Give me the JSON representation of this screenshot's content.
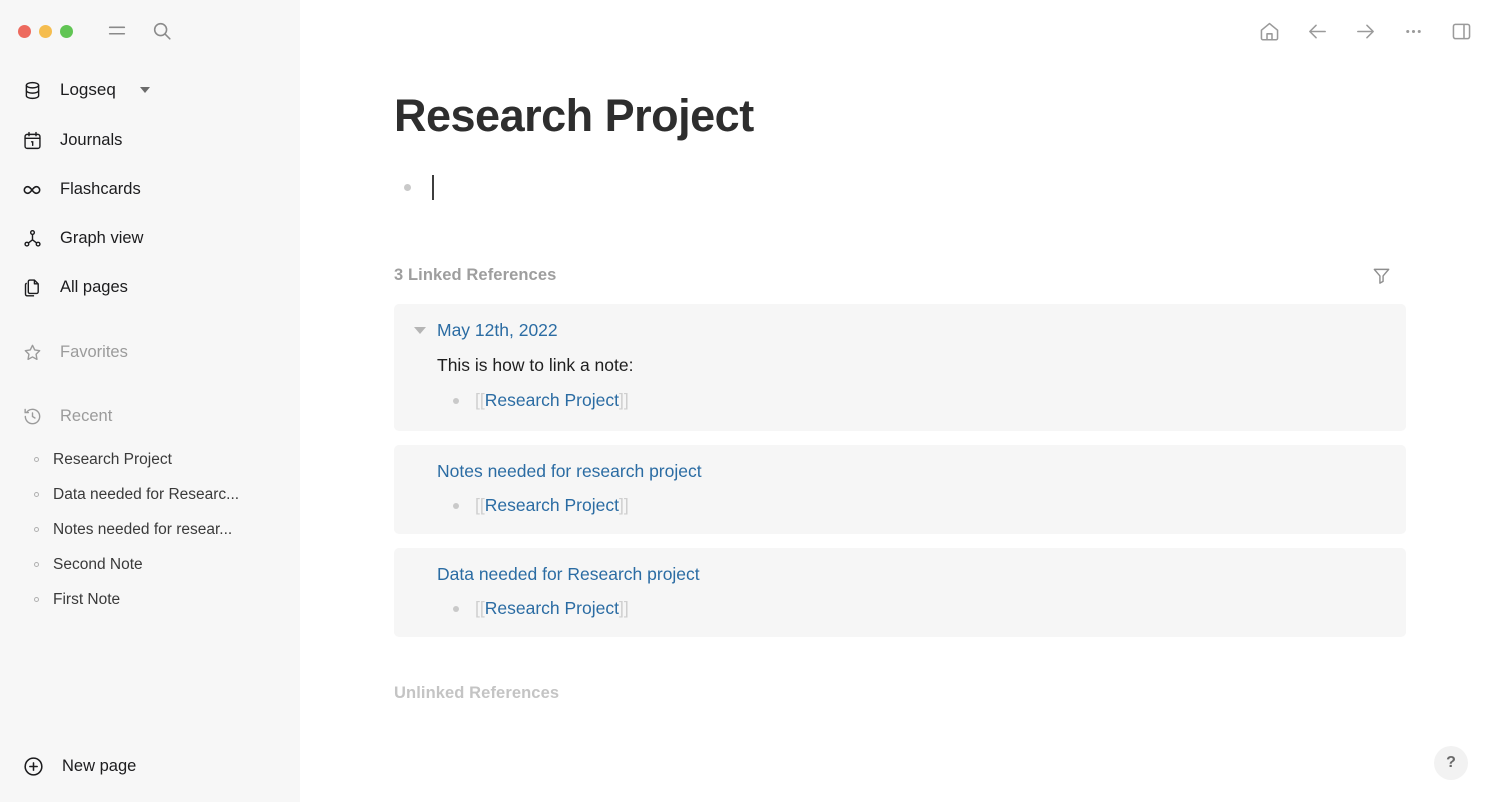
{
  "window": {
    "controls": [
      {
        "name": "close",
        "color": "#ed6a5e"
      },
      {
        "name": "minimize",
        "color": "#f5bd4f"
      },
      {
        "name": "maximize",
        "color": "#61c554"
      }
    ],
    "menu_icon": "hamburger-menu-icon",
    "search_icon": "search-icon"
  },
  "sidebar": {
    "graph": {
      "label": "Logseq",
      "icon": "database-icon",
      "caret": "chevron-down-icon"
    },
    "nav": [
      {
        "label": "Journals",
        "icon": "calendar-icon"
      },
      {
        "label": "Flashcards",
        "icon": "infinity-icon"
      },
      {
        "label": "Graph view",
        "icon": "graph-node-icon"
      },
      {
        "label": "All pages",
        "icon": "pages-copy-icon"
      }
    ],
    "favorites": {
      "label": "Favorites",
      "icon": "star-icon"
    },
    "recent": {
      "label": "Recent",
      "icon": "history-clock-icon"
    },
    "recent_items": [
      {
        "label": "Research Project"
      },
      {
        "label": "Data needed for Researc..."
      },
      {
        "label": "Notes needed for resear..."
      },
      {
        "label": "Second Note"
      },
      {
        "label": "First Note"
      }
    ],
    "new_page": {
      "label": "New page",
      "icon": "plus-circle-icon"
    }
  },
  "toolbar": {
    "buttons": [
      {
        "name": "home-icon"
      },
      {
        "name": "arrow-left-icon"
      },
      {
        "name": "arrow-right-icon"
      },
      {
        "name": "more-horizontal-icon"
      },
      {
        "name": "right-sidebar-toggle-icon"
      }
    ]
  },
  "page": {
    "title": "Research Project",
    "editor_placeholder": ""
  },
  "linked_references": {
    "heading": "3 Linked References",
    "count": 3,
    "filter_icon": "filter-funnel-icon",
    "cards": [
      {
        "source": "May 12th, 2022",
        "collapsible": true,
        "body_text": "This is how to link a note:",
        "child": {
          "open_bracket": "[[",
          "link": "Research Project",
          "close_bracket": "]]"
        }
      },
      {
        "source": "Notes needed for research project",
        "collapsible": false,
        "body_text": "",
        "child": {
          "open_bracket": "[[",
          "link": "Research Project",
          "close_bracket": "]]"
        }
      },
      {
        "source": "Data needed for Research project",
        "collapsible": false,
        "body_text": "",
        "child": {
          "open_bracket": "[[",
          "link": "Research Project",
          "close_bracket": "]]"
        }
      }
    ]
  },
  "unlinked_references": {
    "heading": "Unlinked References"
  },
  "help": {
    "label": "?"
  },
  "colors": {
    "link": "#2b6ca3",
    "sidebar_bg": "#f7f7f7",
    "card_bg": "#f6f6f6",
    "muted_text": "#9e9e9e",
    "body_text": "#1f1f1f"
  }
}
